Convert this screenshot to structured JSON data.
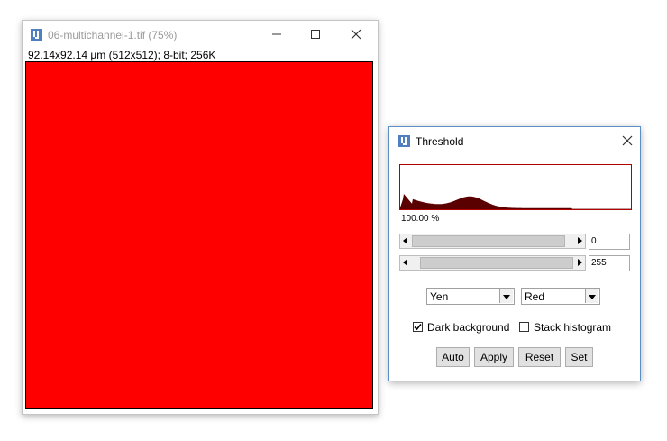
{
  "image_window": {
    "title": "06-multichannel-1.tif (75%)",
    "info": "92.14x92.14 µm (512x512); 8-bit; 256K",
    "canvas_color": "#ff0000",
    "icons": [
      "imagej-icon",
      "minimize-icon",
      "maximize-icon",
      "close-icon"
    ]
  },
  "threshold_window": {
    "title": "Threshold",
    "histogram_percent": "100.00 %",
    "histogram_colors": {
      "frame": "#b00000",
      "fill": "#5a0000"
    },
    "lower_slider": {
      "value": "0",
      "fraction": 0.0
    },
    "upper_slider": {
      "value": "255",
      "fraction": 1.0
    },
    "method": "Yen",
    "display": "Red",
    "dark_background": {
      "label": "Dark background",
      "checked": true
    },
    "stack_histogram": {
      "label": "Stack histogram",
      "checked": false
    },
    "buttons": {
      "auto": "Auto",
      "apply": "Apply",
      "reset": "Reset",
      "set": "Set"
    }
  }
}
